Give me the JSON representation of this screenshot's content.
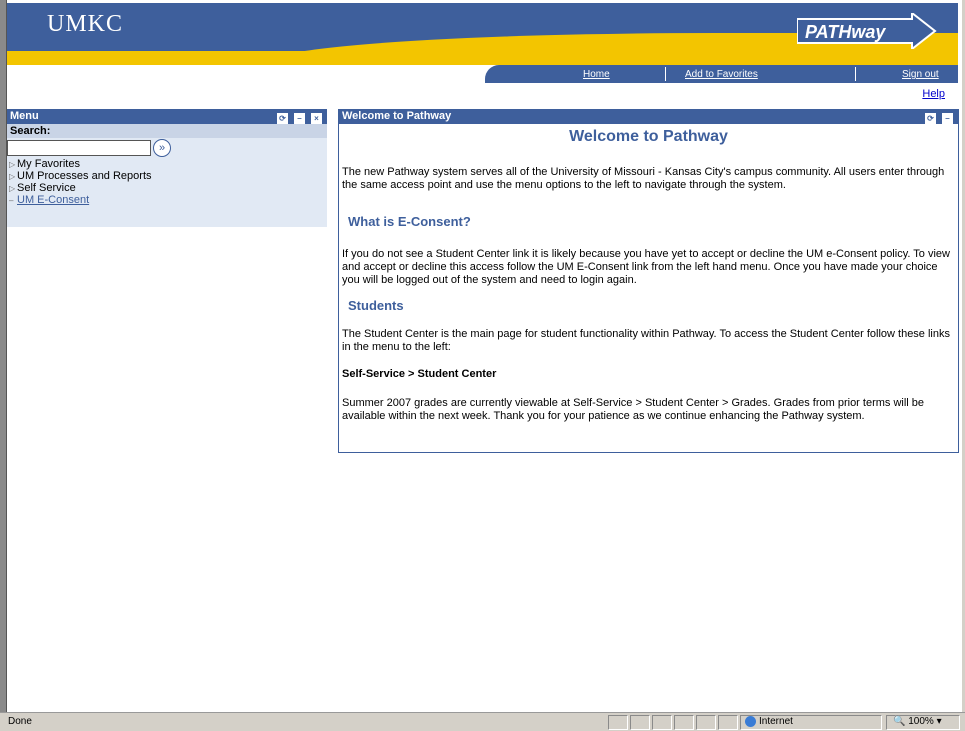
{
  "banner": {
    "logo": "UMKC",
    "pathway_logo": "PATHway"
  },
  "nav": {
    "home": "Home",
    "favorites": "Add to Favorites",
    "signout": "Sign out",
    "help": "Help"
  },
  "menu": {
    "title": "Menu",
    "search_label": "Search:",
    "search_value": "",
    "go_glyph": "»",
    "items": [
      {
        "label": "My Favorites",
        "marker": "▷"
      },
      {
        "label": "UM Processes and Reports",
        "marker": "▷"
      },
      {
        "label": "Self Service",
        "marker": "▷"
      },
      {
        "label": "UM E-Consent",
        "marker": "–"
      }
    ]
  },
  "welcome": {
    "header": "Welcome to Pathway",
    "title": "Welcome to Pathway",
    "intro": "The new Pathway system serves all of the University of Missouri - Kansas City's campus community. All users enter through the same access point and use the menu options to the left to navigate through the system.",
    "h_econsent": "What is E-Consent?",
    "econsent": "If you do not see a Student Center link it is likely because you have yet to accept or decline the UM e-Consent policy. To view and accept or decline this access follow the UM E-Consent link from the left hand menu. Once you have made your choice you will be logged out of the system and need to login again.",
    "h_students": "Students",
    "students": "The Student Center is the main page for student functionality within Pathway. To access the Student Center follow these links in the menu to the left:",
    "path": "Self-Service > Student Center",
    "grades": "Summer 2007 grades are currently viewable at Self-Service > Student Center > Grades. Grades from prior terms will be available within the next week. Thank you for your patience as we continue enhancing the Pathway system."
  },
  "status": {
    "text": "Done",
    "zone": "Internet",
    "zoom": "100%"
  },
  "colors": {
    "brand_blue": "#3e5f9c",
    "gold": "#f3c500",
    "link": "#0000cc"
  }
}
